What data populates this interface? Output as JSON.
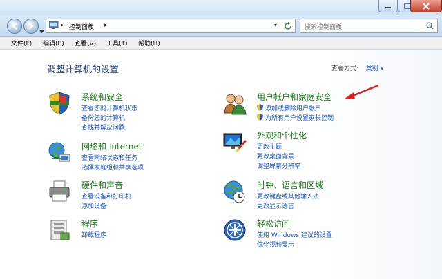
{
  "window": {
    "controls": [
      "minimize",
      "maximize",
      "close"
    ]
  },
  "address": {
    "path": "控制面板",
    "search_placeholder": "搜索控制面板"
  },
  "menu": [
    "文件(F)",
    "编辑(E)",
    "查看(V)",
    "工具(T)",
    "帮助(H)"
  ],
  "main": {
    "heading": "调整计算机的设置",
    "view_by_label": "查看方式:",
    "view_by_value": "类别"
  },
  "categories": [
    {
      "title": "系统和安全",
      "links": [
        "查看您的计算机状态",
        "备份您的计算机",
        "查找并解决问题"
      ],
      "icon": "shield-icon"
    },
    {
      "title": "网络和 Internet",
      "links": [
        "查看网络状态和任务",
        "选择家庭组和共享选项"
      ],
      "icon": "network-icon"
    },
    {
      "title": "硬件和声音",
      "links": [
        "查看设备和打印机",
        "添加设备"
      ],
      "icon": "printer-icon"
    },
    {
      "title": "程序",
      "links": [
        "卸载程序"
      ],
      "icon": "programs-icon"
    },
    {
      "title": "用户帐户和家庭安全",
      "links": [
        "添加或删除用户帐户",
        "为所有用户设置家长控制"
      ],
      "icon": "users-icon"
    },
    {
      "title": "外观和个性化",
      "links": [
        "更改主题",
        "更改桌面背景",
        "调整屏幕分辨率"
      ],
      "icon": "monitor-icon"
    },
    {
      "title": "时钟、语言和区域",
      "links": [
        "更改键盘或其他输入法",
        "更改显示语言"
      ],
      "icon": "globe-clock-icon"
    },
    {
      "title": "轻松访问",
      "links": [
        "使用 Windows 建议的设置",
        "优化视频显示"
      ],
      "icon": "ease-of-access-icon"
    }
  ],
  "colors": {
    "heading": "#1e3c7a",
    "category_title": "#1a7a1a",
    "link": "#1a55c2",
    "annotation_arrow": "#e02020"
  }
}
